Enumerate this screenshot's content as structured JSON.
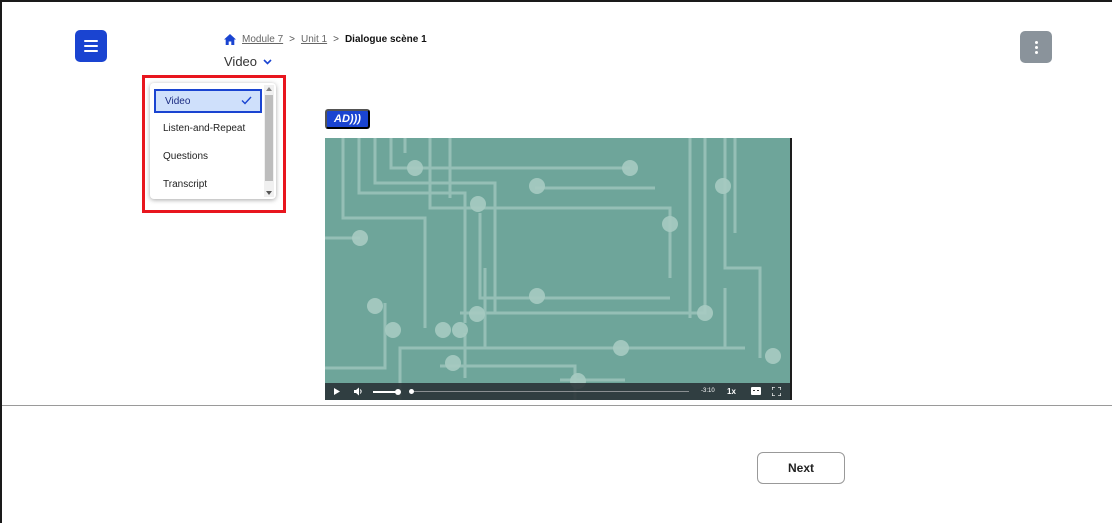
{
  "breadcrumb": {
    "module": "Module 7",
    "unit": "Unit 1",
    "current": "Dialogue scène 1"
  },
  "view_select": {
    "selected": "Video",
    "options": [
      "Video",
      "Listen-and-Repeat",
      "Questions",
      "Transcript"
    ]
  },
  "ad_badge": "AD)))",
  "video": {
    "time_remaining": "-3:10",
    "speed": "1x",
    "volume_level": 0.8,
    "progress": 0.0
  },
  "footer": {
    "next_label": "Next"
  },
  "colors": {
    "primary": "#1a44d1",
    "highlight": "#e8161e",
    "video_bg": "#6ea59a",
    "kebab_bg": "#8a939b"
  }
}
